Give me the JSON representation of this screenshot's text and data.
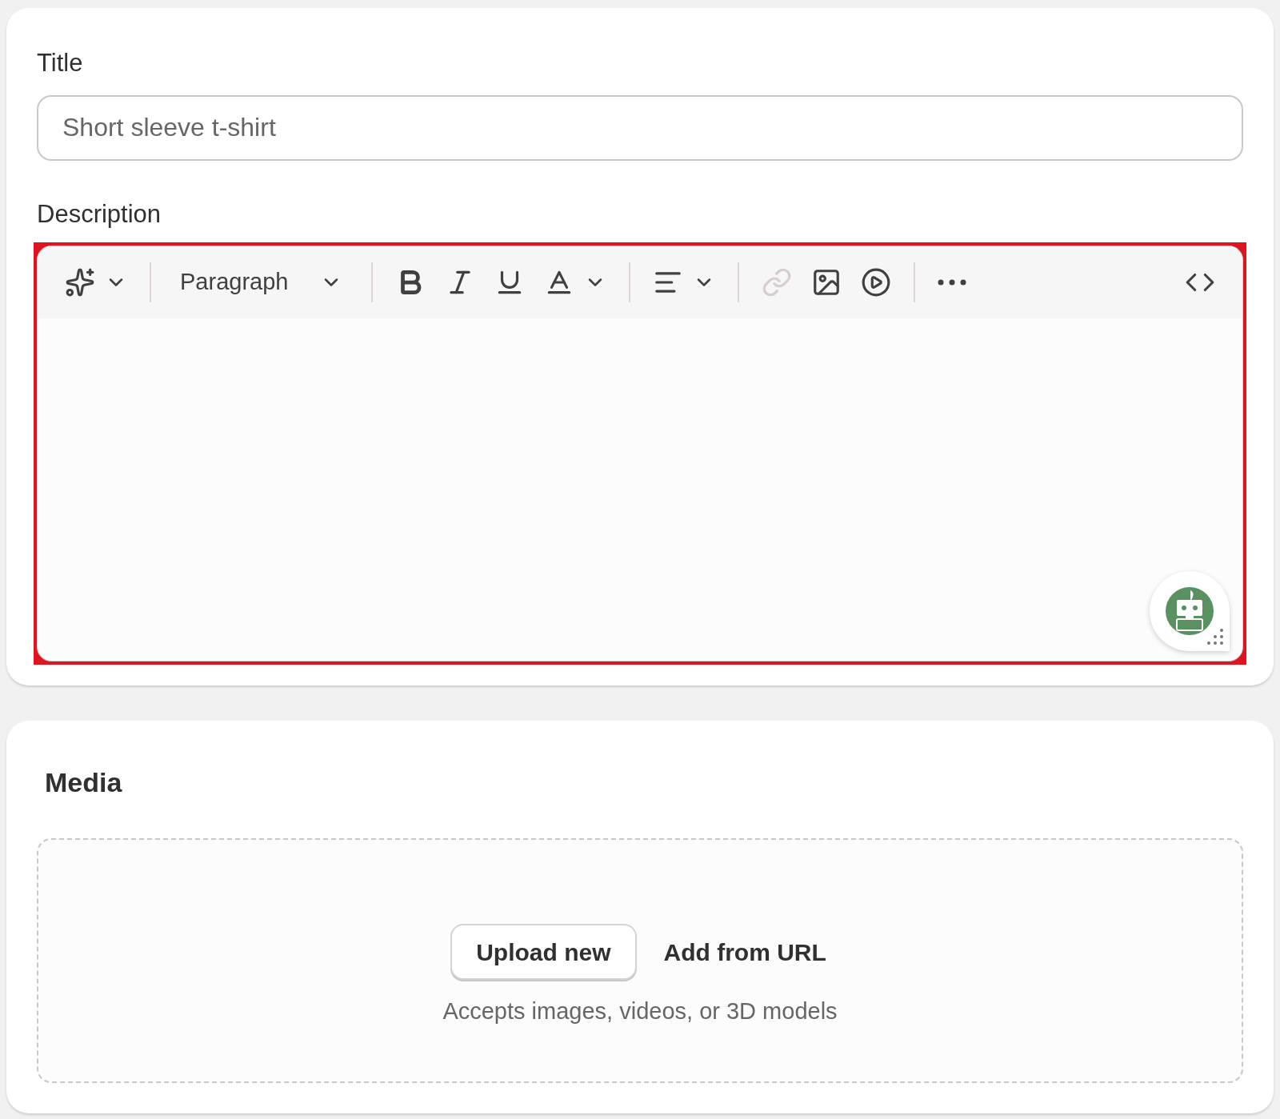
{
  "title_field": {
    "label": "Title",
    "value": "Short sleeve t-shirt"
  },
  "description": {
    "label": "Description",
    "highlighted": true,
    "toolbar": [
      {
        "kind": "sparkle",
        "dropdown": true,
        "disabled": false
      },
      {
        "kind": "divider"
      },
      {
        "kind": "format",
        "text": "Paragraph",
        "dropdown": true,
        "disabled": false
      },
      {
        "kind": "divider"
      },
      {
        "kind": "bold",
        "dropdown": false,
        "disabled": false
      },
      {
        "kind": "italic",
        "dropdown": false,
        "disabled": false
      },
      {
        "kind": "underline",
        "dropdown": false,
        "disabled": false
      },
      {
        "kind": "text-color",
        "dropdown": true,
        "disabled": false
      },
      {
        "kind": "divider"
      },
      {
        "kind": "align",
        "dropdown": true,
        "disabled": false
      },
      {
        "kind": "divider"
      },
      {
        "kind": "link",
        "dropdown": false,
        "disabled": true
      },
      {
        "kind": "image",
        "dropdown": false,
        "disabled": false
      },
      {
        "kind": "video",
        "dropdown": false,
        "disabled": false
      },
      {
        "kind": "divider"
      },
      {
        "kind": "more",
        "dropdown": false,
        "disabled": false
      },
      {
        "kind": "spacer"
      },
      {
        "kind": "code",
        "dropdown": false,
        "disabled": false
      }
    ]
  },
  "media": {
    "heading": "Media",
    "buttons": [
      {
        "label": "Upload new",
        "kind": "outlined"
      },
      {
        "label": "Add from URL",
        "kind": "plain"
      }
    ],
    "hint": "Accepts images, videos, or 3D models"
  }
}
